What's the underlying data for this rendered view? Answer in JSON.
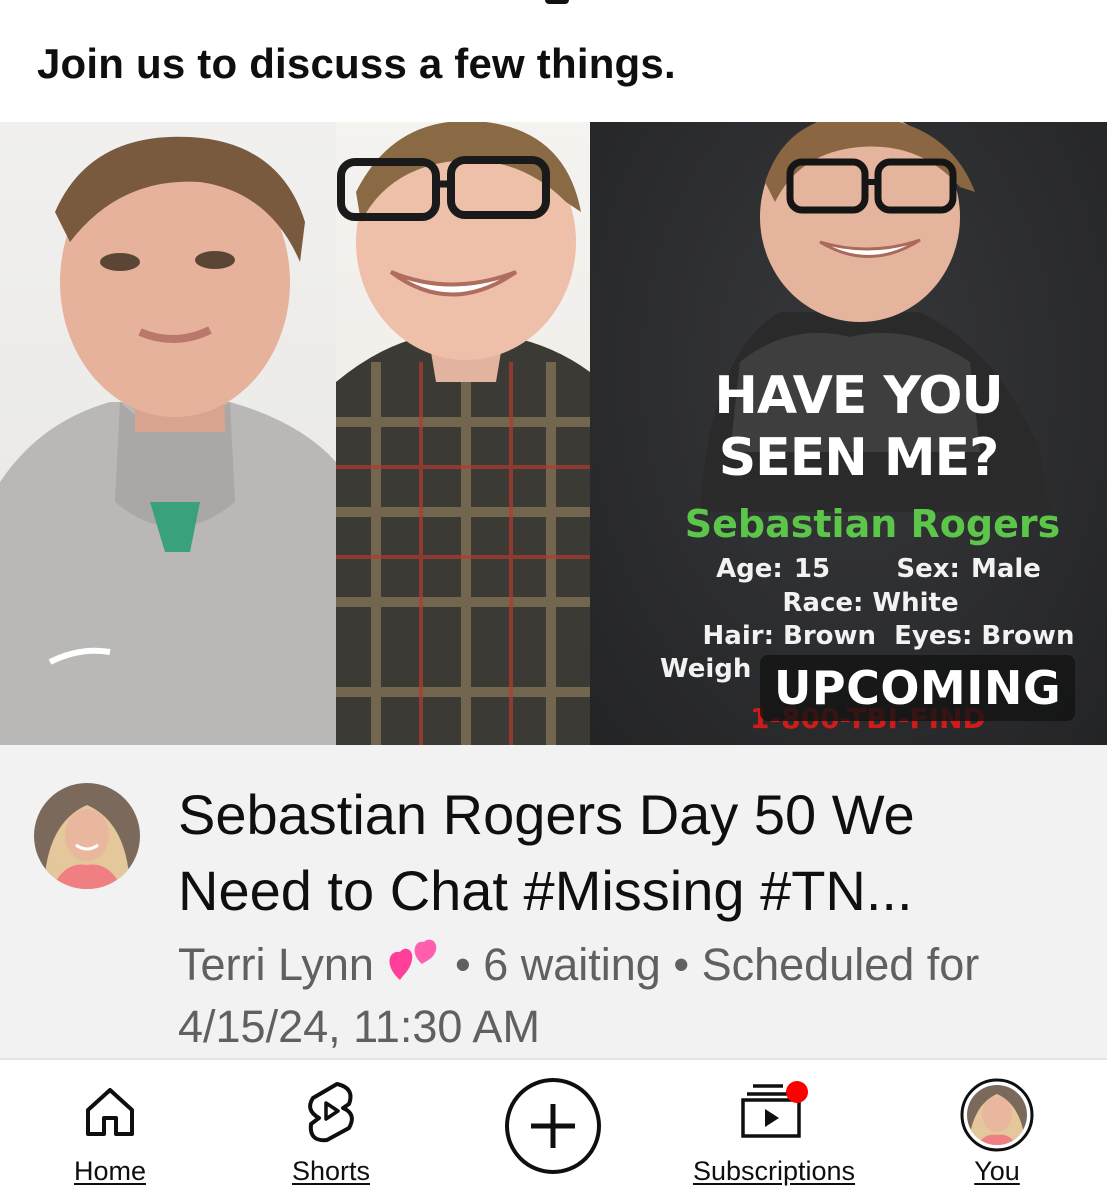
{
  "post": {
    "text": "Join us to discuss a few things."
  },
  "thumbnail": {
    "poster_headline_line1": "HAVE YOU",
    "poster_headline_line2": "SEEN ME?",
    "poster_name": "Sebastian Rogers",
    "poster_age_sex": "Age: 15      Sex: Male",
    "poster_race": "Race: White",
    "poster_hair_eyes": "Hair: Brown  Eyes: Brown",
    "poster_weight_height": "Weigh",
    "poster_phone": "1-800-TBI-FIND",
    "badge": "UPCOMING",
    "colors": {
      "poster_bg": "#2f3033",
      "poster_name": "#5cc64a",
      "poster_phone": "#d01b1b"
    }
  },
  "video": {
    "title": "Sebastian Rogers Day 50 We Need to Chat #Missing #TN...",
    "channel": "Terri Lynn",
    "channel_emoji_icon": "two-hearts-icon",
    "waiting": "• 6 waiting",
    "scheduled": "• Scheduled for 4/15/24, 11:30 AM"
  },
  "bottom_nav": {
    "items": [
      {
        "label": "Home",
        "icon": "home-icon"
      },
      {
        "label": "Shorts",
        "icon": "shorts-icon"
      },
      {
        "label": "",
        "icon": "create-plus-icon"
      },
      {
        "label": "Subscriptions",
        "icon": "subscriptions-icon"
      },
      {
        "label": "You",
        "icon": "profile-avatar"
      }
    ],
    "notification_dot_color": "#ff0000"
  }
}
